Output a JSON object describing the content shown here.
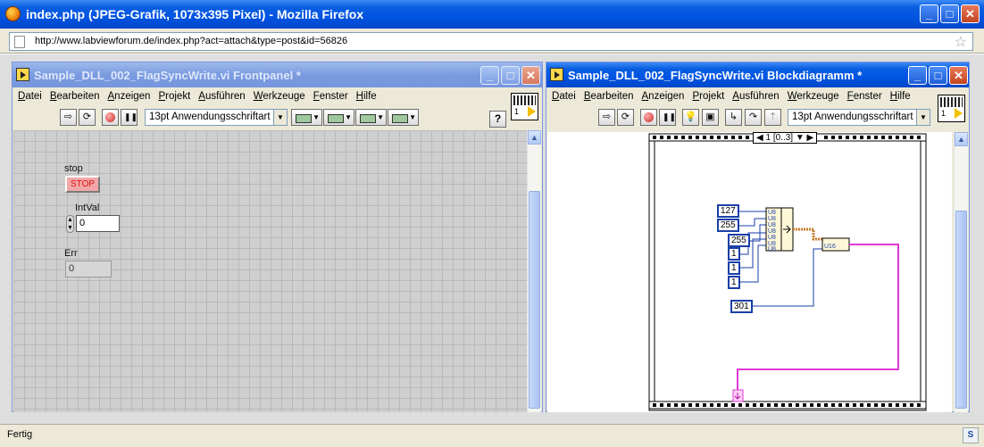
{
  "browser": {
    "title": "index.php (JPEG-Grafik, 1073x395 Pixel) - Mozilla Firefox",
    "url": "http://www.labviewforum.de/index.php?act=attach&type=post&id=56826",
    "status": "Fertig"
  },
  "window_buttons": {
    "minimize": "_",
    "maximize": "□",
    "close": "✕"
  },
  "front_panel": {
    "title": "Sample_DLL_002_FlagSyncWrite.vi Frontpanel *",
    "menu": [
      "Datei",
      "Bearbeiten",
      "Anzeigen",
      "Projekt",
      "Ausführen",
      "Werkzeuge",
      "Fenster",
      "Hilfe"
    ],
    "font_selector": "13pt Anwendungsschriftart",
    "help": "?",
    "vi_icon_number": "1",
    "controls": {
      "stop_label": "stop",
      "stop_button": "STOP",
      "intval_label": "IntVal",
      "intval_value": "0",
      "err_label": "Err",
      "err_value": "0"
    }
  },
  "block_diagram": {
    "title": "Sample_DLL_002_FlagSyncWrite.vi Blockdiagramm *",
    "menu": [
      "Datei",
      "Bearbeiten",
      "Anzeigen",
      "Projekt",
      "Ausführen",
      "Werkzeuge",
      "Fenster",
      "Hilfe"
    ],
    "font_selector": "13pt Anwendungsschriftart",
    "vi_icon_number": "1",
    "sequence_frame": "1 [0..3]",
    "constants": [
      "127",
      "255",
      "255",
      "1",
      "1",
      "1",
      "301"
    ],
    "build_array_terminals": [
      "U8",
      "U8",
      "U8",
      "U8",
      "U8",
      "U8",
      "U8"
    ],
    "node_type": "U16"
  },
  "colors": {
    "titlebar_active": "#0054e3",
    "u8_wire": "#1a3fa8",
    "cluster_wire": "#c87a2a",
    "string_wire": "#e03ad8"
  }
}
